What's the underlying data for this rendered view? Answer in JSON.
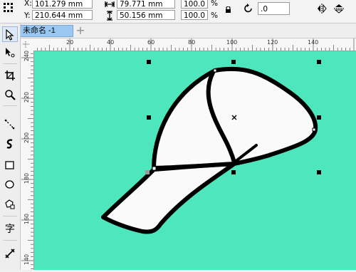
{
  "property_bar": {
    "x_label": "X:",
    "x_value": "101.279 mm",
    "y_label": "Y:",
    "y_value": "210.644 mm",
    "width_value": "79.771 mm",
    "height_value": "50.156 mm",
    "scale_x": "100.0",
    "scale_y": "100.0",
    "percent_symbol": "%",
    "rotation_value": ".0"
  },
  "tabs": {
    "document_tab": "未命名 -1",
    "add_tab": "+"
  },
  "toolbox": {
    "text_tool_char": "字"
  },
  "rulers": {
    "horizontal_labels": [
      "20",
      "40",
      "60",
      "80",
      "100",
      "120",
      "140"
    ],
    "vertical_labels": [
      "240",
      "220",
      "200",
      "180",
      "160",
      "140"
    ]
  },
  "colors": {
    "canvas_bg": "#4ee6bc",
    "cap_fill": "#fafafa",
    "cap_outline": "#000000",
    "active_tab": "#9bc8f2"
  },
  "icons": [
    "grid-icon",
    "width-icon",
    "height-icon",
    "lock-icon",
    "rotate-icon",
    "mirror-horizontal-icon",
    "mirror-vertical-icon",
    "pointer-icon",
    "shape-icon",
    "crop-icon",
    "zoom-icon",
    "freehand-icon",
    "artistic-media-icon",
    "rectangle-icon",
    "ellipse-icon",
    "polygon-icon",
    "text-icon",
    "dimension-icon"
  ]
}
